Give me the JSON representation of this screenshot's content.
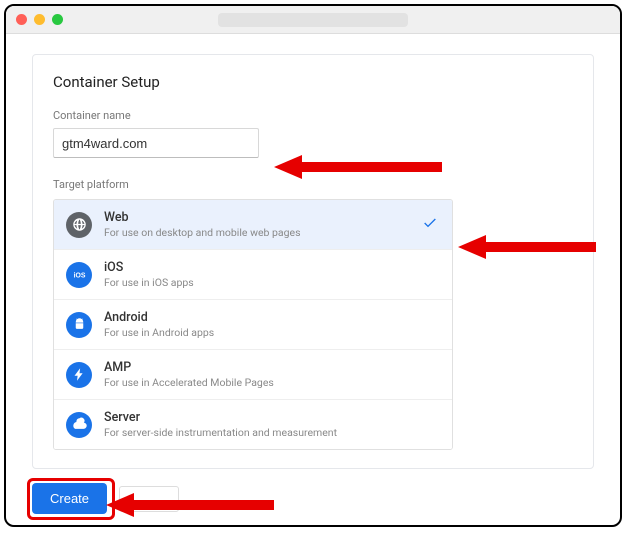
{
  "page": {
    "title": "Container Setup",
    "container_name_label": "Container name",
    "container_name_value": "gtm4ward.com",
    "target_platform_label": "Target platform"
  },
  "platforms": [
    {
      "id": "web",
      "name": "Web",
      "desc": "For use on desktop and mobile web pages",
      "selected": true,
      "icon_bg": "#5f6368"
    },
    {
      "id": "ios",
      "name": "iOS",
      "desc": "For use in iOS apps",
      "selected": false,
      "icon_bg": "#1a73e8"
    },
    {
      "id": "android",
      "name": "Android",
      "desc": "For use in Android apps",
      "selected": false,
      "icon_bg": "#1a73e8"
    },
    {
      "id": "amp",
      "name": "AMP",
      "desc": "For use in Accelerated Mobile Pages",
      "selected": false,
      "icon_bg": "#1a73e8"
    },
    {
      "id": "server",
      "name": "Server",
      "desc": "For server-side instrumentation and measurement",
      "selected": false,
      "icon_bg": "#1a73e8"
    }
  ],
  "actions": {
    "create_label": "Create"
  },
  "colors": {
    "accent": "#1a73e8",
    "highlight": "#e60000"
  }
}
